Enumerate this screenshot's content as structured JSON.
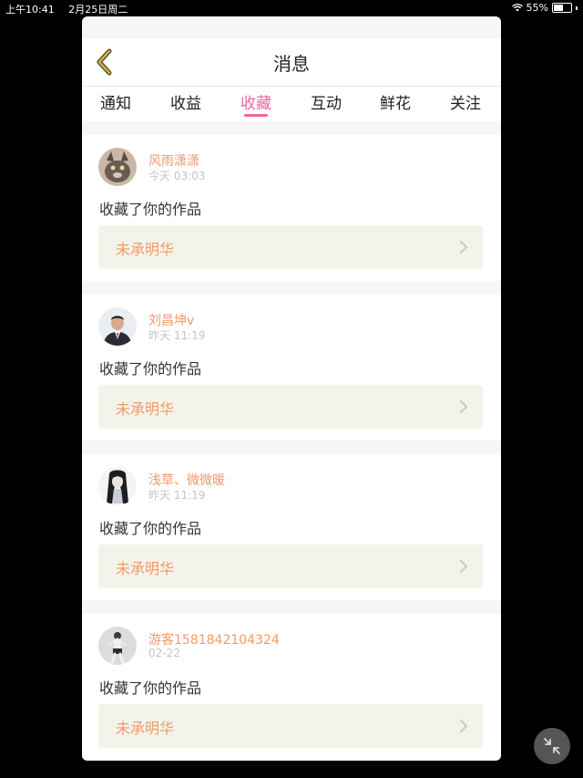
{
  "status_bar": {
    "time": "上午10:41",
    "date": "2月25日周二",
    "battery": "55%",
    "battery_level": 0.55
  },
  "nav": {
    "title": "消息"
  },
  "tabs": [
    {
      "label": "通知"
    },
    {
      "label": "收益"
    },
    {
      "label": "收藏",
      "active": true
    },
    {
      "label": "互动"
    },
    {
      "label": "鲜花"
    },
    {
      "label": "关注"
    }
  ],
  "items": [
    {
      "username": "风雨潇潇",
      "time": "今天 03:03",
      "action": "收藏了你的作品",
      "work": "未承明华",
      "avatar": "cat-avatar"
    },
    {
      "username": "刘昌坤v",
      "time": "昨天 11:19",
      "action": "收藏了你的作品",
      "work": "未承明华",
      "avatar": "man-avatar"
    },
    {
      "username": "浅草、微微暖",
      "time": "昨天 11:19",
      "action": "收藏了你的作品",
      "work": "未承明华",
      "avatar": "anime-avatar"
    },
    {
      "username": "游客1581842104324",
      "time": "02-22",
      "action": "收藏了你的作品",
      "work": "未承明华",
      "avatar": "person-avatar"
    }
  ],
  "icons": {
    "back": "chevron-left-icon",
    "work_arrow": "chevron-right-icon",
    "fab": "collapse-arrows-icon"
  },
  "colors": {
    "accent": "#e9689f",
    "username": "#f09a6c",
    "work_box": "#f4f3ea",
    "back_icon": "#d4b12d"
  }
}
